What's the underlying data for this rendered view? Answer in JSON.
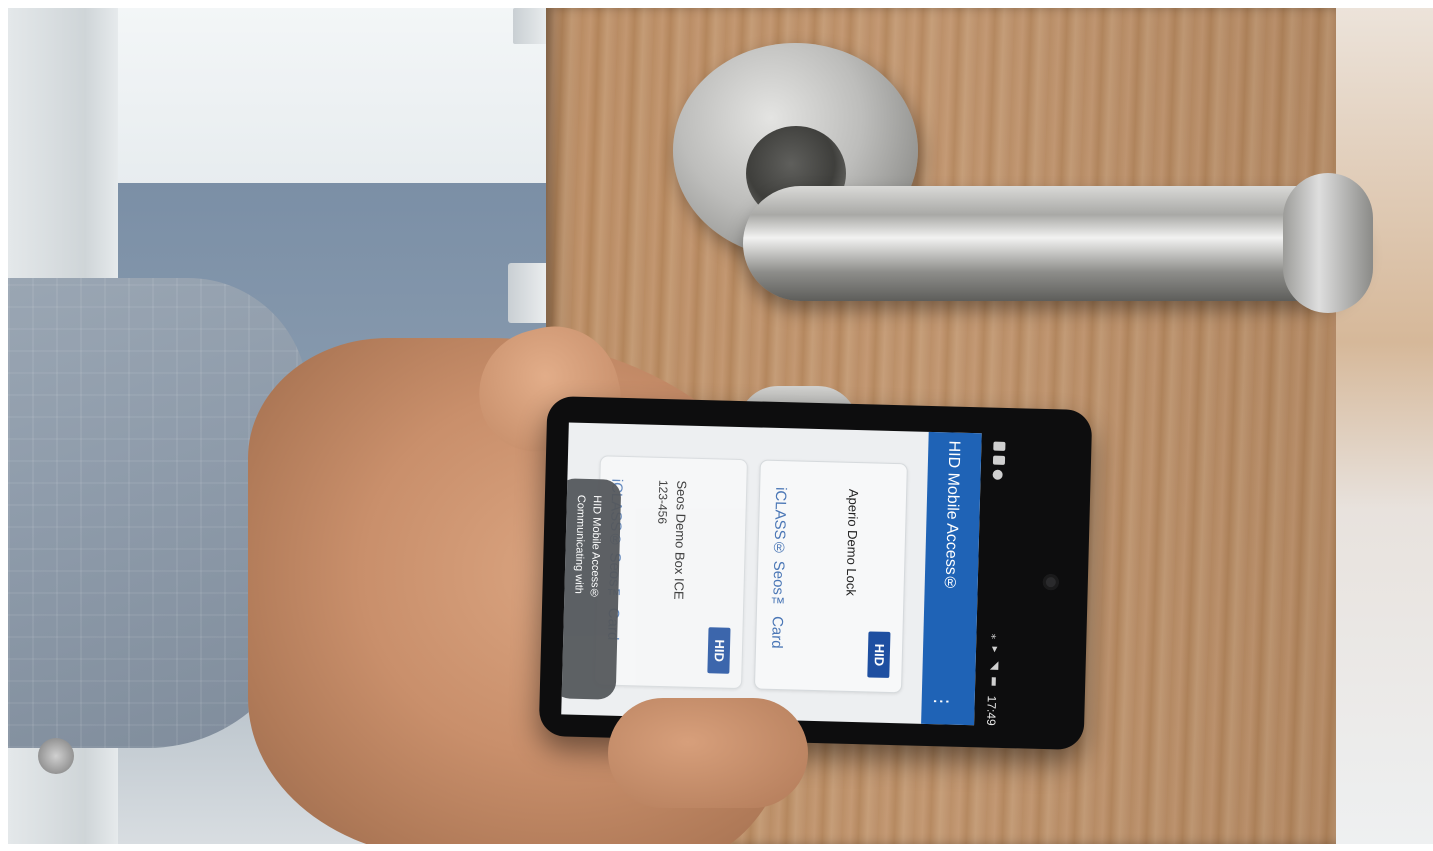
{
  "phone_app": {
    "title": "HID Mobile Access®",
    "status_time": "17:49",
    "status_icons": "⁎ ▾ ◢ ▮",
    "cards": [
      {
        "name": "Aperio Demo Lock",
        "subtitle": "",
        "type": "iCLASS® Seos™ Card",
        "logo": "HID"
      },
      {
        "name": "Seos Demo Box ICE",
        "subtitle": "123-456",
        "type": "iCLASS® Seos™ Card",
        "logo": "HID"
      }
    ],
    "toast": {
      "line1": "HID Mobile Access®",
      "line2": "Communicating with"
    }
  },
  "colors": {
    "app_bar": "#1f63b6",
    "hid_logo": "#1e4fa1",
    "card_type_text": "#4b77b6",
    "toast_bg": "#55585c"
  },
  "icons": {
    "menu": "more-vertical-icon",
    "status": [
      "bluetooth-icon",
      "wifi-icon",
      "signal-icon",
      "battery-icon"
    ]
  }
}
